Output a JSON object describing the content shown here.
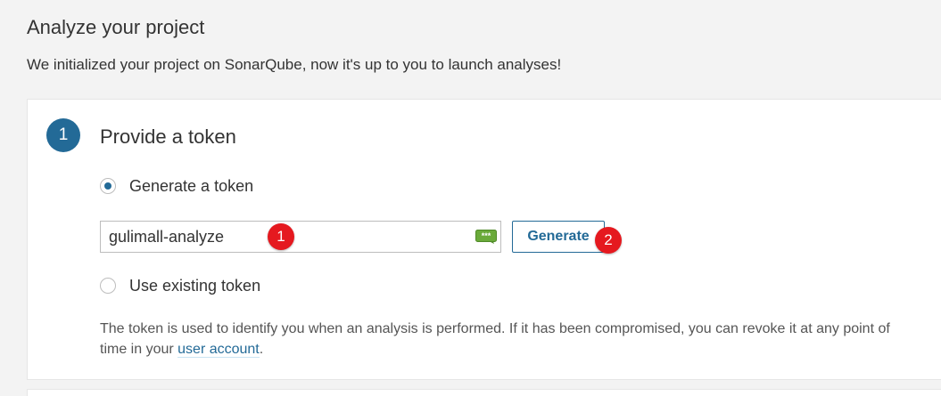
{
  "page": {
    "title": "Analyze your project",
    "description": "We initialized your project on SonarQube, now it's up to you to launch analyses!"
  },
  "step": {
    "number": "1",
    "title": "Provide a token",
    "accent_color": "#236a97"
  },
  "options": {
    "generate_label": "Generate a token",
    "generate_selected": true,
    "existing_label": "Use existing token",
    "existing_selected": false
  },
  "token_input": {
    "value": "gulimall-analyze",
    "icon": "password-manager-icon"
  },
  "generate_button": {
    "label": "Generate"
  },
  "annotations": {
    "marker_1": "1",
    "marker_2": "2",
    "color": "#e5191f"
  },
  "help": {
    "text_before": "The token is used to identify you when an analysis is performed. If it has been compromised, you can revoke it at any point of time in your ",
    "link_text": "user account",
    "text_after": "."
  }
}
